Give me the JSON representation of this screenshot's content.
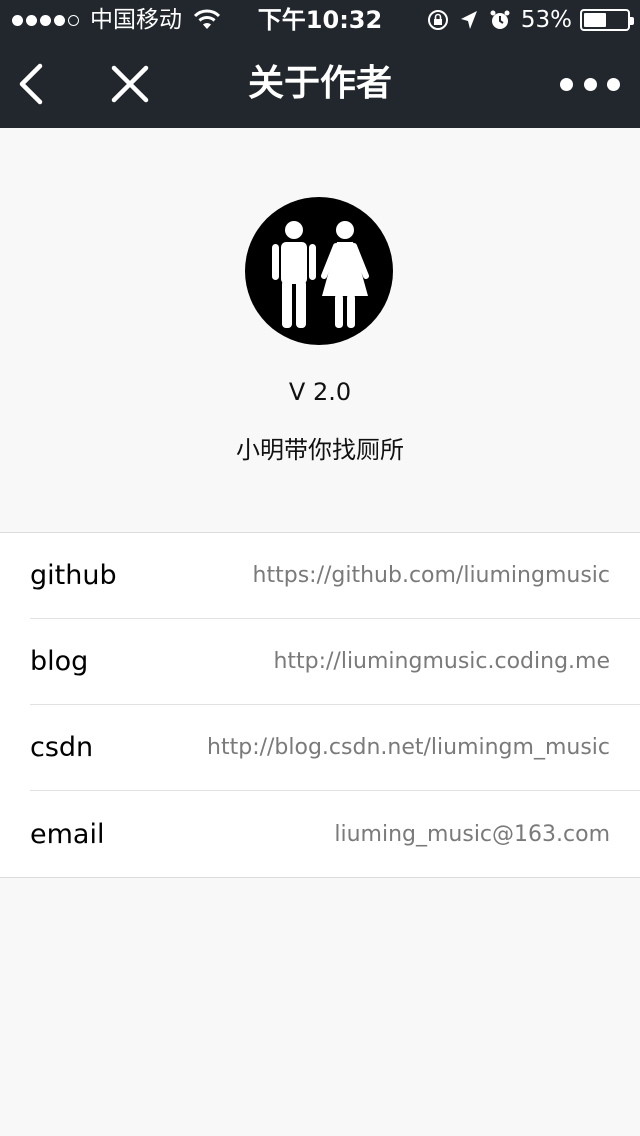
{
  "statusbar": {
    "carrier": "中国移动",
    "time": "下午10:32",
    "battery_pct": "53%",
    "battery_level": 0.53
  },
  "navbar": {
    "title": "关于作者",
    "back_icon": "chevron-left-icon",
    "close_icon": "close-icon",
    "more_icon": "more-dots-icon"
  },
  "profile": {
    "logo_icon": "restroom-icon",
    "version": "V 2.0",
    "app_name": "小明带你找厕所"
  },
  "links": [
    {
      "label": "github",
      "value": "https://github.com/liumingmusic"
    },
    {
      "label": "blog",
      "value": "http://liumingmusic.coding.me"
    },
    {
      "label": "csdn",
      "value": "http://blog.csdn.net/liumingm_music"
    },
    {
      "label": "email",
      "value": "liuming_music@163.com"
    }
  ],
  "colors": {
    "navbar_bg": "#22262d",
    "page_bg": "#f8f8f8",
    "value_text": "#7a7a7a"
  }
}
